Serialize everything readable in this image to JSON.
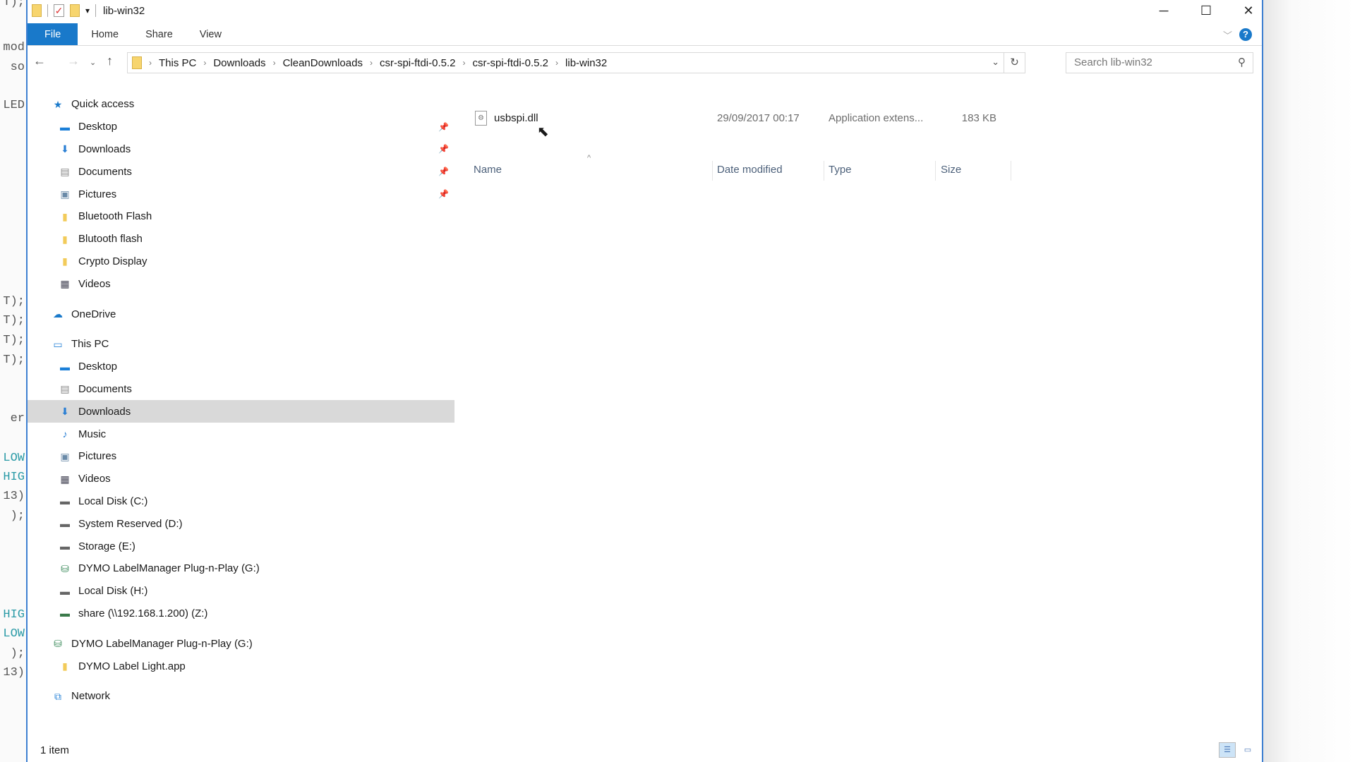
{
  "window": {
    "title": "lib-win32"
  },
  "ribbon": {
    "tabs": [
      "File",
      "Home",
      "Share",
      "View"
    ],
    "help": "?"
  },
  "address": {
    "crumbs": [
      "This PC",
      "Downloads",
      "CleanDownloads",
      "csr-spi-ftdi-0.5.2",
      "csr-spi-ftdi-0.5.2",
      "lib-win32"
    ]
  },
  "search": {
    "placeholder": "Search lib-win32"
  },
  "sidebar": {
    "items": [
      {
        "label": "Quick access",
        "icon": "star-icon",
        "hdr": true
      },
      {
        "label": "Desktop",
        "icon": "desktop-icon",
        "pin": true
      },
      {
        "label": "Downloads",
        "icon": "download-icon",
        "pin": true
      },
      {
        "label": "Documents",
        "icon": "documents-icon",
        "pin": true
      },
      {
        "label": "Pictures",
        "icon": "pictures-icon",
        "pin": true
      },
      {
        "label": "Bluetooth Flash",
        "icon": "folder-icon"
      },
      {
        "label": "Blutooth flash",
        "icon": "folder-icon"
      },
      {
        "label": "Crypto Display",
        "icon": "folder-icon"
      },
      {
        "label": "Videos",
        "icon": "videos-icon"
      },
      {
        "label": "OneDrive",
        "icon": "cloud-icon",
        "hdr": true
      },
      {
        "label": "This PC",
        "icon": "computer-icon",
        "hdr": true
      },
      {
        "label": "Desktop",
        "icon": "desktop-icon"
      },
      {
        "label": "Documents",
        "icon": "documents-icon"
      },
      {
        "label": "Downloads",
        "icon": "download-icon",
        "selected": true
      },
      {
        "label": "Music",
        "icon": "music-icon"
      },
      {
        "label": "Pictures",
        "icon": "pictures-icon"
      },
      {
        "label": "Videos",
        "icon": "videos-icon"
      },
      {
        "label": "Local Disk (C:)",
        "icon": "drive-icon"
      },
      {
        "label": "System Reserved (D:)",
        "icon": "drive-icon"
      },
      {
        "label": "Storage (E:)",
        "icon": "drive-icon"
      },
      {
        "label": "DYMO LabelManager Plug-n-Play (G:)",
        "icon": "usb-drive-icon"
      },
      {
        "label": "Local Disk (H:)",
        "icon": "drive-icon"
      },
      {
        "label": "share (\\\\192.168.1.200) (Z:)",
        "icon": "network-drive-icon"
      },
      {
        "label": "DYMO LabelManager Plug-n-Play (G:)",
        "icon": "usb-drive-icon",
        "hdr": true
      },
      {
        "label": "DYMO Label Light.app",
        "icon": "folder-icon"
      },
      {
        "label": "Network",
        "icon": "network-icon",
        "hdr": true
      }
    ]
  },
  "columns": {
    "name": "Name",
    "date": "Date modified",
    "type": "Type",
    "size": "Size"
  },
  "files": [
    {
      "name": "usbspi.dll",
      "date": "29/09/2017 00:17",
      "type": "Application extens...",
      "size": "183 KB"
    }
  ],
  "status": {
    "count": "1 item"
  },
  "background_code": [
    "T);",
    "T);",
    "T);",
    "T);",
    "er",
    "LOW",
    "HIG",
    "13)",
    ");",
    "HIG",
    "LOW",
    ");",
    "13)",
    "mod",
    "so",
    "LED"
  ],
  "colors": {
    "accent": "#1979ca",
    "selected": "#d9d9d9"
  }
}
